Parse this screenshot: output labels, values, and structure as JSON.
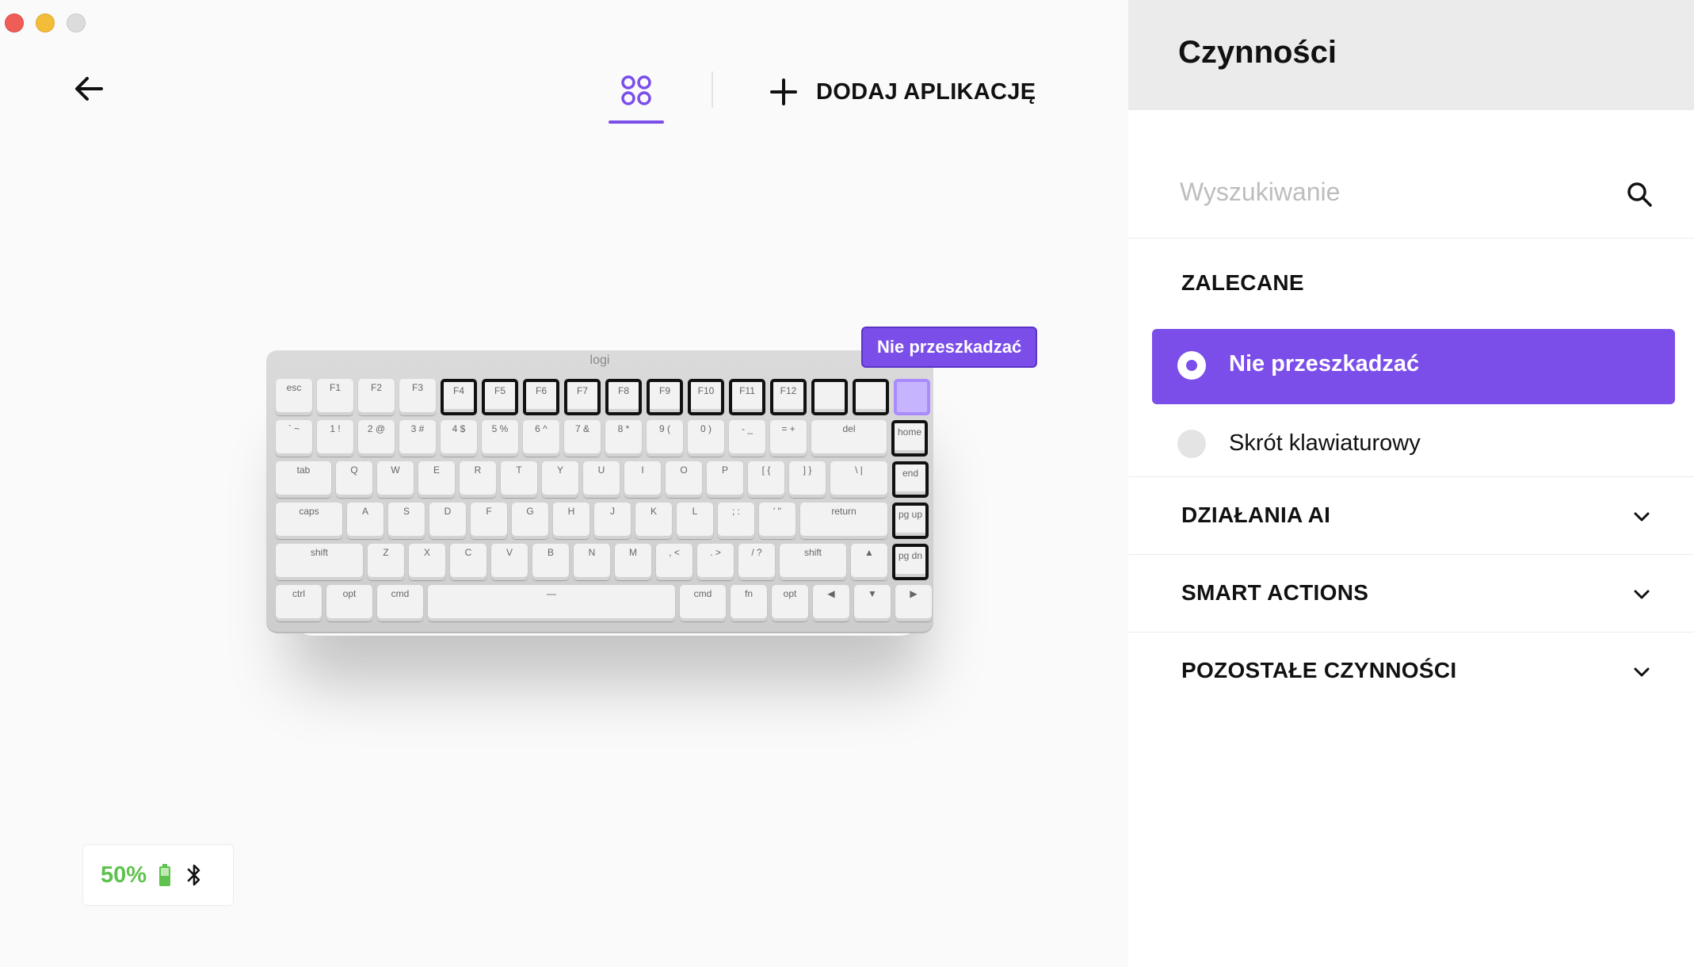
{
  "panel": {
    "title": "Czynności",
    "search": {
      "placeholder": "Wyszukiwanie"
    },
    "recommended_heading": "ZALECANE",
    "options": [
      {
        "label": "Nie przeszkadzać",
        "selected": true
      },
      {
        "label": "Skrót klawiaturowy",
        "selected": false
      }
    ],
    "sections": [
      {
        "label": "DZIAŁANIA AI"
      },
      {
        "label": "SMART ACTIONS"
      },
      {
        "label": "POZOSTAŁE CZYNNOŚCI"
      }
    ]
  },
  "toolbar": {
    "add_app_label": "DODAJ APLIKACJĘ"
  },
  "tooltip": {
    "label": "Nie przeszkadzać"
  },
  "device": {
    "brand": "logi",
    "battery_percent": "50%",
    "connection_icon": "bluetooth-icon"
  },
  "keyboard_rows": [
    [
      "esc",
      "F1",
      "F2",
      "F3",
      "F4",
      "F5",
      "F6",
      "F7",
      "F8",
      "F9",
      "F10",
      "F11",
      "F12",
      "",
      "",
      ""
    ],
    [
      "` ~",
      "1 !",
      "2 @",
      "3 #",
      "4 $",
      "5 %",
      "6 ^",
      "7 &",
      "8 *",
      "9 (",
      "0 )",
      "- _",
      "= +",
      "del",
      "home"
    ],
    [
      "tab",
      "Q",
      "W",
      "E",
      "R",
      "T",
      "Y",
      "U",
      "I",
      "O",
      "P",
      "[ {",
      "] }",
      "\\ |",
      "end"
    ],
    [
      "caps",
      "A",
      "S",
      "D",
      "F",
      "G",
      "H",
      "J",
      "K",
      "L",
      "; :",
      "' \"",
      "return",
      "pg up"
    ],
    [
      "shift",
      "Z",
      "X",
      "C",
      "V",
      "B",
      "N",
      "M",
      ", <",
      ". >",
      "/ ?",
      "shift",
      "▲",
      "pg dn"
    ],
    [
      "ctrl",
      "opt",
      "cmd",
      "—",
      "cmd",
      "fn",
      "opt",
      "◀",
      "▼",
      "▶"
    ]
  ],
  "colors": {
    "accent": "#7b4eea",
    "battery": "#5fc24e"
  }
}
